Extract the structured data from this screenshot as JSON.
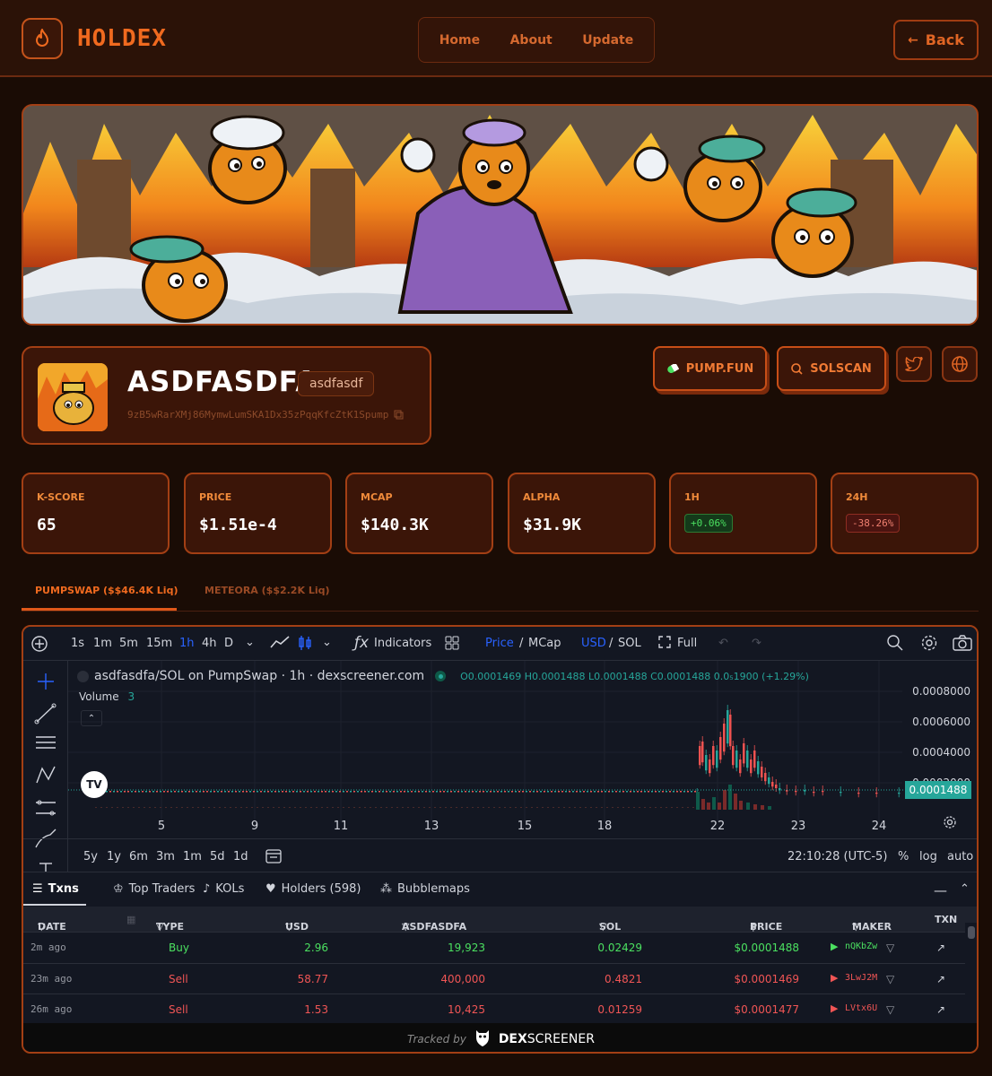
{
  "header": {
    "brand": "HOLDEX",
    "nav": [
      "Home",
      "About",
      "Update"
    ],
    "back_label": "Back"
  },
  "token": {
    "name": "ASDFASDFA",
    "ticker": "asdfasdf",
    "address": "9zB5wRarXMj86MymwLumSKA1Dx35zPqqKfcZtK1Spump"
  },
  "actions": {
    "pumpfun": "PUMP.FUN",
    "solscan": "SOLSCAN"
  },
  "stats": [
    {
      "label": "K-SCORE",
      "value": "65"
    },
    {
      "label": "PRICE",
      "value": "$1.51e-4"
    },
    {
      "label": "MCAP",
      "value": "$140.3K"
    },
    {
      "label": "ALPHA",
      "value": "$31.9K"
    },
    {
      "label": "1H",
      "value": "+0.06%"
    },
    {
      "label": "24H",
      "value": "-38.26%"
    }
  ],
  "pool_tabs": [
    "PUMPSWAP ($$46.4K Liq)",
    "METEORA ($$2.2K Liq)"
  ],
  "chart_toolbar": {
    "intervals": [
      "1s",
      "1m",
      "5m",
      "15m",
      "1h",
      "4h",
      "D"
    ],
    "indicators": "Indicators",
    "price": "Price",
    "mcap": "MCap",
    "usd": "USD",
    "sol": "SOL",
    "full": "Full"
  },
  "chart_legend": {
    "pair": "asdfasdfa/SOL on PumpSwap · 1h · dexscreener.com",
    "ohlc": "O0.0001469 H0.0001488 L0.0001488 C0.0001488 0.0₅1900 (+1.29%)",
    "volume_label": "Volume",
    "volume_value": "3",
    "last_price": "0.0001488"
  },
  "chart_data": {
    "type": "line",
    "x_ticks": [
      "5",
      "9",
      "11",
      "13",
      "15",
      "18",
      "22",
      "23",
      "24"
    ],
    "y_ticks": [
      "0.0008000",
      "0.0006000",
      "0.0004000",
      "0.0002000"
    ],
    "ylim": [
      0,
      0.0009
    ]
  },
  "chart_bottom": {
    "ranges": [
      "5y",
      "1y",
      "6m",
      "3m",
      "1m",
      "5d",
      "1d"
    ],
    "time": "22:10:28 (UTC-5)",
    "percent": "%",
    "log": "log",
    "auto": "auto"
  },
  "table_tabs": [
    "Txns",
    "Top Traders",
    "KOLs",
    "Holders (598)",
    "Bubblemaps"
  ],
  "table_headers": [
    "DATE",
    "TYPE",
    "USD",
    "ASDFASDFA",
    "SOL",
    "PRICE",
    "MAKER",
    "TXN"
  ],
  "transactions": [
    {
      "date": "2m ago",
      "type": "Buy",
      "usd": "2.96",
      "amount": "19,923",
      "sol": "0.02429",
      "price": "$0.0001488",
      "maker": "nQKbZw"
    },
    {
      "date": "23m ago",
      "type": "Sell",
      "usd": "58.77",
      "amount": "400,000",
      "sol": "0.4821",
      "price": "$0.0001469",
      "maker": "3LwJ2M"
    },
    {
      "date": "26m ago",
      "type": "Sell",
      "usd": "1.53",
      "amount": "10,425",
      "sol": "0.01259",
      "price": "$0.0001477",
      "maker": "LVtx6U"
    }
  ],
  "footer": {
    "tracked_by": "Tracked by",
    "dex": "DEX",
    "screener": "SCREENER"
  },
  "colors": {
    "accent": "#f06a1f",
    "buy": "#4be060",
    "sell": "#f05555"
  }
}
